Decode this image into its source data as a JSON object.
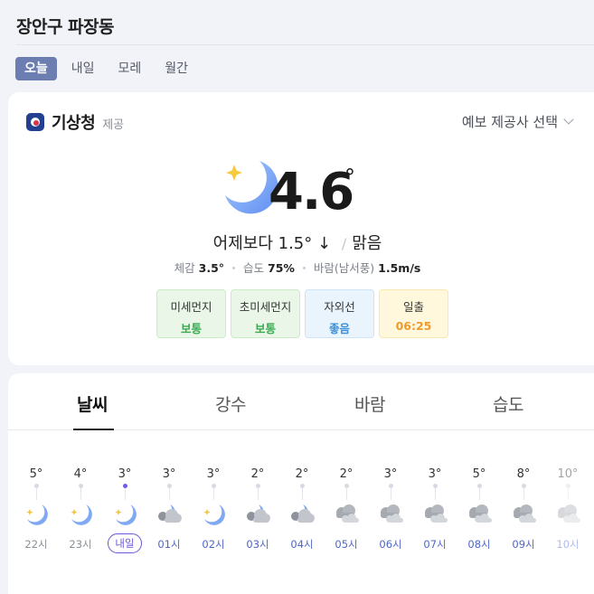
{
  "location": {
    "title": "장안구 파장동"
  },
  "day_tabs": [
    {
      "label": "오늘",
      "active": true
    },
    {
      "label": "내일"
    },
    {
      "label": "모레"
    },
    {
      "label": "월간"
    }
  ],
  "provider": {
    "name": "기상청",
    "suffix": "제공",
    "select_label": "예보 제공사 선택"
  },
  "current": {
    "icon": "crescent-moon-star-icon",
    "temp": "4.6",
    "degree": "°",
    "compare_label": "어제보다",
    "compare_value": "1.5°",
    "compare_arrow": "↓",
    "separator": "/",
    "condition": "맑음",
    "feels_label": "체감",
    "feels_value": "3.5°",
    "humidity_label": "습도",
    "humidity_value": "75%",
    "wind_label": "바람(남서풍)",
    "wind_value": "1.5m/s"
  },
  "badges": [
    {
      "label": "미세먼지",
      "value": "보통",
      "color": "#39a94f"
    },
    {
      "label": "초미세먼지",
      "value": "보통",
      "color": "#39a94f"
    },
    {
      "label": "자외선",
      "value": "좋음",
      "color": "#3e8fd9"
    },
    {
      "label": "일출",
      "value": "06:25",
      "color": "#f09a2c"
    }
  ],
  "hourly_tabs": [
    {
      "label": "날씨",
      "active": true
    },
    {
      "label": "강수"
    },
    {
      "label": "바람"
    },
    {
      "label": "습도"
    }
  ],
  "hourly": [
    {
      "temp": "5°",
      "icon": "crescent-moon-star-icon",
      "label": "22시"
    },
    {
      "temp": "4°",
      "icon": "crescent-moon-star-icon",
      "label": "23시"
    },
    {
      "temp": "3°",
      "icon": "crescent-moon-star-icon",
      "label": "내일",
      "now": true
    },
    {
      "temp": "3°",
      "icon": "moon-cloud-icon",
      "label": "01시"
    },
    {
      "temp": "3°",
      "icon": "crescent-moon-star-icon",
      "label": "02시"
    },
    {
      "temp": "2°",
      "icon": "moon-cloud-icon",
      "label": "03시"
    },
    {
      "temp": "2°",
      "icon": "moon-cloud-icon",
      "label": "04시"
    },
    {
      "temp": "2°",
      "icon": "cloudy-icon",
      "label": "05시"
    },
    {
      "temp": "3°",
      "icon": "cloudy-icon",
      "label": "06시"
    },
    {
      "temp": "3°",
      "icon": "cloudy-icon",
      "label": "07시"
    },
    {
      "temp": "5°",
      "icon": "cloudy-icon",
      "label": "08시"
    },
    {
      "temp": "8°",
      "icon": "cloudy-icon",
      "label": "09시"
    },
    {
      "temp": "10°",
      "icon": "cloudy-icon",
      "label": "10시"
    }
  ]
}
